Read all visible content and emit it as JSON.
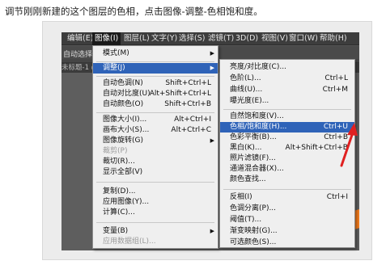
{
  "instruction": "调节刚刚新建的这个图层的色相，点击图像-调整-色相饱和度。",
  "menubar": [
    "编辑(E)",
    "图像(I)",
    "图层(L)",
    "文字(Y)",
    "选择(S)",
    "滤镜(T)",
    "3D(D)",
    "视图(V)",
    "窗口(W)",
    "帮助(H)"
  ],
  "optbar_label": "自动选择：",
  "tab_label": "未标题-1 @",
  "image_menu": [
    {
      "label": "模式(M)",
      "shortcut": "",
      "submenu": true
    },
    {
      "label": "调整(J)",
      "shortcut": "",
      "submenu": true
    },
    {
      "label": "自动色调(N)",
      "shortcut": "Shift+Ctrl+L"
    },
    {
      "label": "自动对比度(U)",
      "shortcut": "Alt+Shift+Ctrl+L"
    },
    {
      "label": "自动颜色(O)",
      "shortcut": "Shift+Ctrl+B"
    },
    {
      "label": "图像大小(I)...",
      "shortcut": "Alt+Ctrl+I"
    },
    {
      "label": "画布大小(S)...",
      "shortcut": "Alt+Ctrl+C"
    },
    {
      "label": "图像旋转(G)",
      "shortcut": "",
      "submenu": true
    },
    {
      "label": "裁剪(P)",
      "shortcut": "",
      "disabled": true
    },
    {
      "label": "裁切(R)...",
      "shortcut": ""
    },
    {
      "label": "显示全部(V)",
      "shortcut": ""
    },
    {
      "label": "复制(D)...",
      "shortcut": ""
    },
    {
      "label": "应用图像(Y)...",
      "shortcut": ""
    },
    {
      "label": "计算(C)...",
      "shortcut": ""
    },
    {
      "label": "变量(B)",
      "shortcut": "",
      "submenu": true
    },
    {
      "label": "应用数据组(L)...",
      "shortcut": "",
      "disabled": true
    }
  ],
  "adjust_menu": [
    {
      "label": "亮度/对比度(C)...",
      "shortcut": ""
    },
    {
      "label": "色阶(L)...",
      "shortcut": "Ctrl+L"
    },
    {
      "label": "曲线(U)...",
      "shortcut": "Ctrl+M"
    },
    {
      "label": "曝光度(E)...",
      "shortcut": ""
    },
    {
      "label": "自然饱和度(V)...",
      "shortcut": ""
    },
    {
      "label": "色相/饱和度(H)...",
      "shortcut": "Ctrl+U"
    },
    {
      "label": "色彩平衡(B)...",
      "shortcut": "Ctrl+B"
    },
    {
      "label": "黑白(K)...",
      "shortcut": "Alt+Shift+Ctrl+B"
    },
    {
      "label": "照片滤镜(F)...",
      "shortcut": ""
    },
    {
      "label": "通道混合器(X)...",
      "shortcut": ""
    },
    {
      "label": "颜色查找...",
      "shortcut": ""
    },
    {
      "label": "反相(I)",
      "shortcut": "Ctrl+I"
    },
    {
      "label": "色调分离(P)...",
      "shortcut": ""
    },
    {
      "label": "阈值(T)...",
      "shortcut": ""
    },
    {
      "label": "渐变映射(G)...",
      "shortcut": ""
    },
    {
      "label": "可选颜色(S)...",
      "shortcut": ""
    }
  ],
  "colors": {
    "highlight": "#2f63b8",
    "arrow": "#e02020",
    "accent_orange": "#f07a1c"
  }
}
